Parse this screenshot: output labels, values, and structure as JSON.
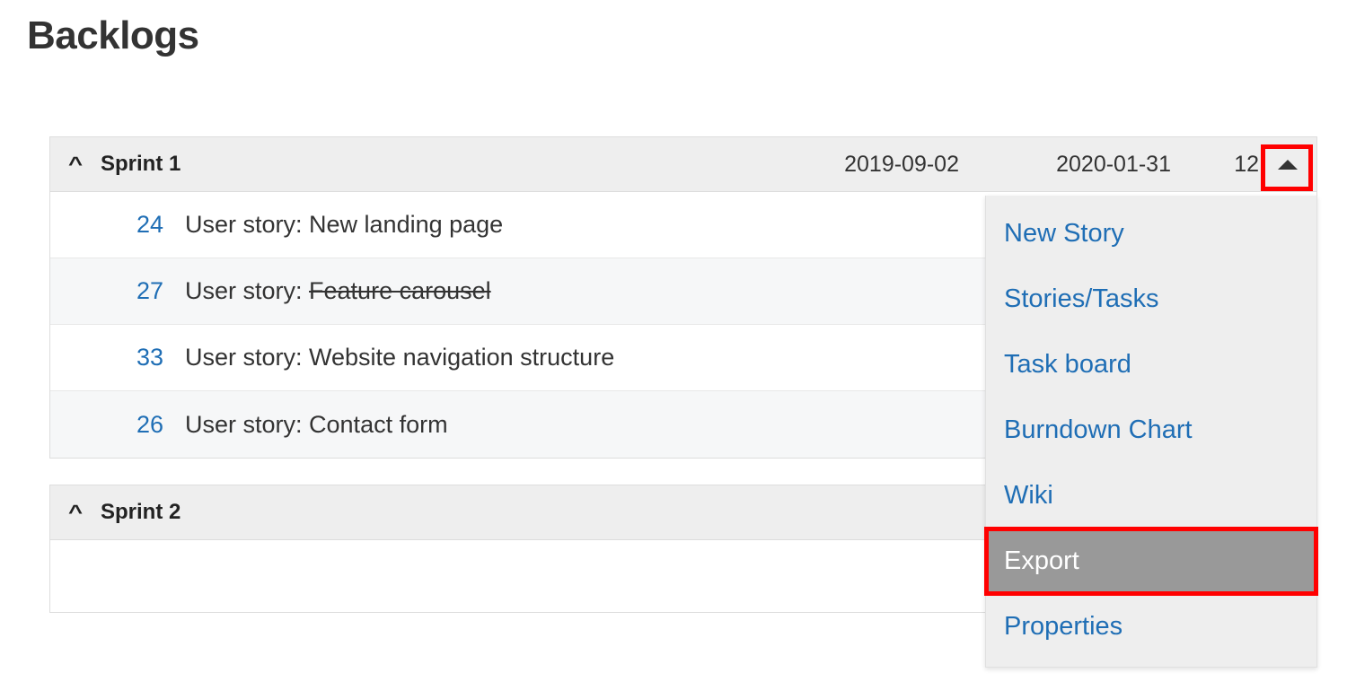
{
  "page": {
    "title": "Backlogs"
  },
  "icons": {
    "collapse_chevron": "^",
    "dropdown_caret": "caret-up-icon"
  },
  "colors": {
    "link": "#1f6eb5",
    "header_bg": "#eeeeee",
    "row_alt_bg": "#f6f7f8",
    "highlight_bg": "#999999",
    "highlight_text": "#ffffff",
    "annotation": "#ff0000"
  },
  "sprints": [
    {
      "name": "Sprint 1",
      "start_date": "2019-09-02",
      "end_date": "2020-01-31",
      "count": "12",
      "stories": [
        {
          "id": "24",
          "prefix": "User story: ",
          "title": "New landing page",
          "struck": false
        },
        {
          "id": "27",
          "prefix": "User story: ",
          "title": "Feature carousel",
          "struck": true
        },
        {
          "id": "33",
          "prefix": "User story: ",
          "title": "Website navigation structure",
          "struck": false
        },
        {
          "id": "26",
          "prefix": "User story: ",
          "title": "Contact form",
          "struck": false
        }
      ]
    },
    {
      "name": "Sprint 2",
      "start_date": "",
      "end_date": "",
      "count": "",
      "stories": []
    }
  ],
  "menu": {
    "items": [
      {
        "label": "New Story",
        "highlighted": false
      },
      {
        "label": "Stories/Tasks",
        "highlighted": false
      },
      {
        "label": "Task board",
        "highlighted": false
      },
      {
        "label": "Burndown Chart",
        "highlighted": false
      },
      {
        "label": "Wiki",
        "highlighted": false
      },
      {
        "label": "Export",
        "highlighted": true
      },
      {
        "label": "Properties",
        "highlighted": false
      }
    ]
  }
}
